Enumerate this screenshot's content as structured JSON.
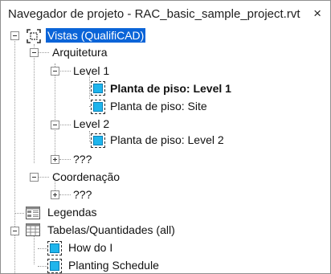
{
  "window": {
    "title": "Navegador de projeto - RAC_basic_sample_project.rvt",
    "close_label": "×"
  },
  "tree": {
    "root": "Vistas (QualifiCAD)",
    "arquitetura": "Arquitetura",
    "level1": "Level 1",
    "level1_child1": "Planta de piso: Level 1",
    "level1_child2": "Planta de piso: Site",
    "level2": "Level 2",
    "level2_child1": "Planta de piso: Level 2",
    "unknown1": "???",
    "coordenacao": "Coordenação",
    "unknown2": "???",
    "legendas": "Legendas",
    "tabelas": "Tabelas/Quantidades (all)",
    "tabelas_child1": "How do I",
    "tabelas_child2": "Planting Schedule"
  },
  "colors": {
    "selection": "#0a64d8",
    "view_icon": "#1fb5ec"
  }
}
